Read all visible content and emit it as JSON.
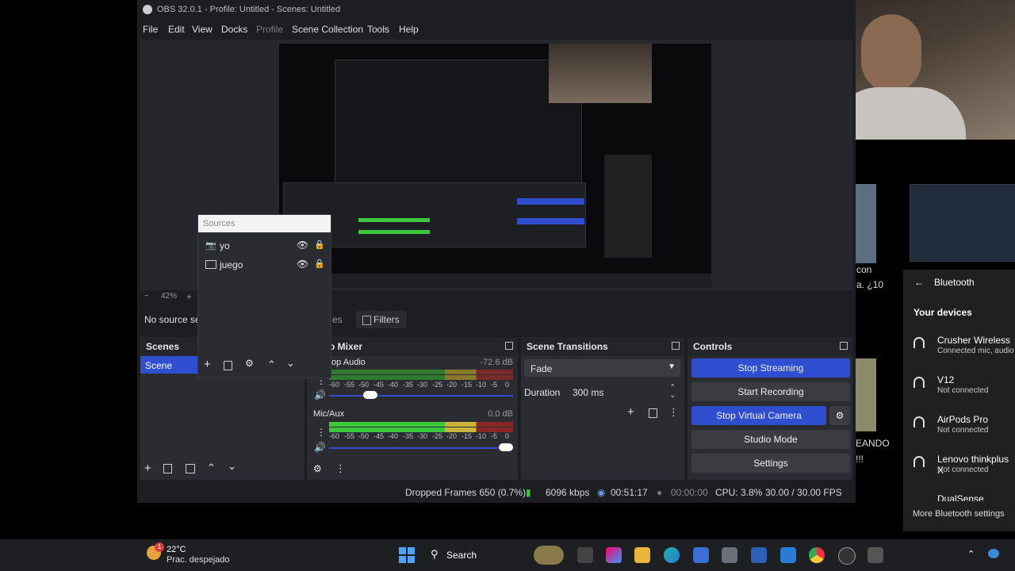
{
  "window": {
    "title": "OBS 32.0.1 - Profile: Untitled - Scenes: Untitled"
  },
  "menu": [
    "File",
    "Edit",
    "View",
    "Docks",
    "Profile",
    "Scene Collection",
    "Tools",
    "Help"
  ],
  "preview": {
    "zoom": "42%",
    "zoom_minus": "−",
    "zoom_plus": "+"
  },
  "info_bar": {
    "no_source": "No source sel",
    "properties_fragment": "es",
    "filters": "Filters"
  },
  "sources": {
    "title": "Sources",
    "items": [
      {
        "name": "yo",
        "icon": "camera-icon"
      },
      {
        "name": "juego",
        "icon": "monitor-icon"
      }
    ]
  },
  "scenes": {
    "title": "Scenes",
    "items": [
      "Scene"
    ]
  },
  "mixer": {
    "title": "o Mixer",
    "channels": [
      {
        "name": "top Audio",
        "db": "-72.6 dB",
        "volume": 0.2
      },
      {
        "name": "Mic/Aux",
        "db": "0.0 dB",
        "volume": 1.0
      }
    ],
    "ticks": [
      "-60",
      "-55",
      "-50",
      "-45",
      "-40",
      "-35",
      "-30",
      "-25",
      "-20",
      "-15",
      "-10",
      "-5",
      "0"
    ]
  },
  "transitions": {
    "title": "Scene Transitions",
    "selected": "Fade",
    "duration_label": "Duration",
    "duration_value": "300 ms"
  },
  "controls": {
    "title": "Controls",
    "stop_streaming": "Stop Streaming",
    "start_recording": "Start Recording",
    "stop_virtual_camera": "Stop Virtual Camera",
    "studio_mode": "Studio Mode",
    "settings": "Settings"
  },
  "status": {
    "dropped": "Dropped Frames 650 (0.7%)",
    "kbps": "6096 kbps",
    "stream_time": "00:51:17",
    "rec_time": "00:00:00",
    "cpu": "CPU: 3.8%",
    "fps": "30.00 / 30.00 FPS"
  },
  "background": {
    "text_con": "con",
    "text_a10": "a. ¿10",
    "text_endo": "EANDO",
    "text_excl": "!!!"
  },
  "bluetooth": {
    "title": "Bluetooth",
    "section": "Your devices",
    "devices": [
      {
        "name": "Crusher Wireless",
        "status": "Connected mic, audio"
      },
      {
        "name": "V12",
        "status": "Not connected"
      },
      {
        "name": "AirPods Pro",
        "status": "Not connected"
      },
      {
        "name": "Lenovo thinkplus X",
        "status": "Not connected"
      },
      {
        "name": "DualSense Wireless",
        "status": ""
      }
    ],
    "more": "More Bluetooth settings"
  },
  "taskbar": {
    "temp": "22°C",
    "weather": "Prac. despejado",
    "badge": "1",
    "search": "Search"
  },
  "colors": {
    "accent": "#2f4fd0",
    "meter_green": "#3cc83c",
    "meter_yellow": "#c8b43c",
    "meter_red": "#c83c3c"
  }
}
